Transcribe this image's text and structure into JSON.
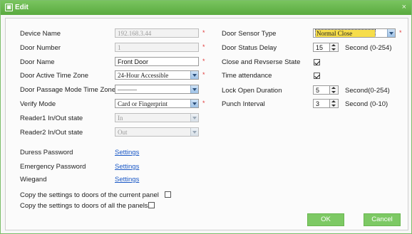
{
  "window": {
    "title": "Edit",
    "close_glyph": "×"
  },
  "left": {
    "device_name": {
      "label": "Device Name",
      "value": "192.168.3.44"
    },
    "door_number": {
      "label": "Door Number",
      "value": "1"
    },
    "door_name": {
      "label": "Door Name",
      "value": "Front Door"
    },
    "active_tz": {
      "label": "Door Active Time Zone",
      "value": "24-Hour Accessible"
    },
    "passage_tz": {
      "label": "Door Passage Mode Time Zone",
      "value": "———"
    },
    "verify_mode": {
      "label": "Verify Mode",
      "value": "Card or Fingerprint"
    },
    "reader1": {
      "label": "Reader1 In/Out state",
      "value": "In"
    },
    "reader2": {
      "label": "Reader2 In/Out state",
      "value": "Out"
    },
    "duress": {
      "label": "Duress Password",
      "link": "Settings"
    },
    "emergency": {
      "label": "Emergency Password",
      "link": "Settings"
    },
    "wiegand": {
      "label": "Wiegand",
      "link": "Settings"
    }
  },
  "right": {
    "sensor_type": {
      "label": "Door Sensor Type",
      "value": "Normal Close"
    },
    "status_delay": {
      "label": "Door Status Delay",
      "value": "15",
      "unit": "Second (0-254)"
    },
    "close_reverse": {
      "label": "Close and Revserse State",
      "checked": true
    },
    "time_attendance": {
      "label": "Time attendance",
      "checked": true
    },
    "lock_open": {
      "label": "Lock Open Duration",
      "value": "5",
      "unit": "Second(0-254)"
    },
    "punch_interval": {
      "label": "Punch Interval",
      "value": "3",
      "unit": "Second (0-10)"
    }
  },
  "copy": {
    "current_panel": {
      "label": "Copy the settings to doors of the current panel",
      "checked": false
    },
    "all_panels": {
      "label": "Copy the settings to doors of all the panels",
      "checked": false
    }
  },
  "required_mark": "*",
  "buttons": {
    "ok": "OK",
    "cancel": "Cancel"
  }
}
